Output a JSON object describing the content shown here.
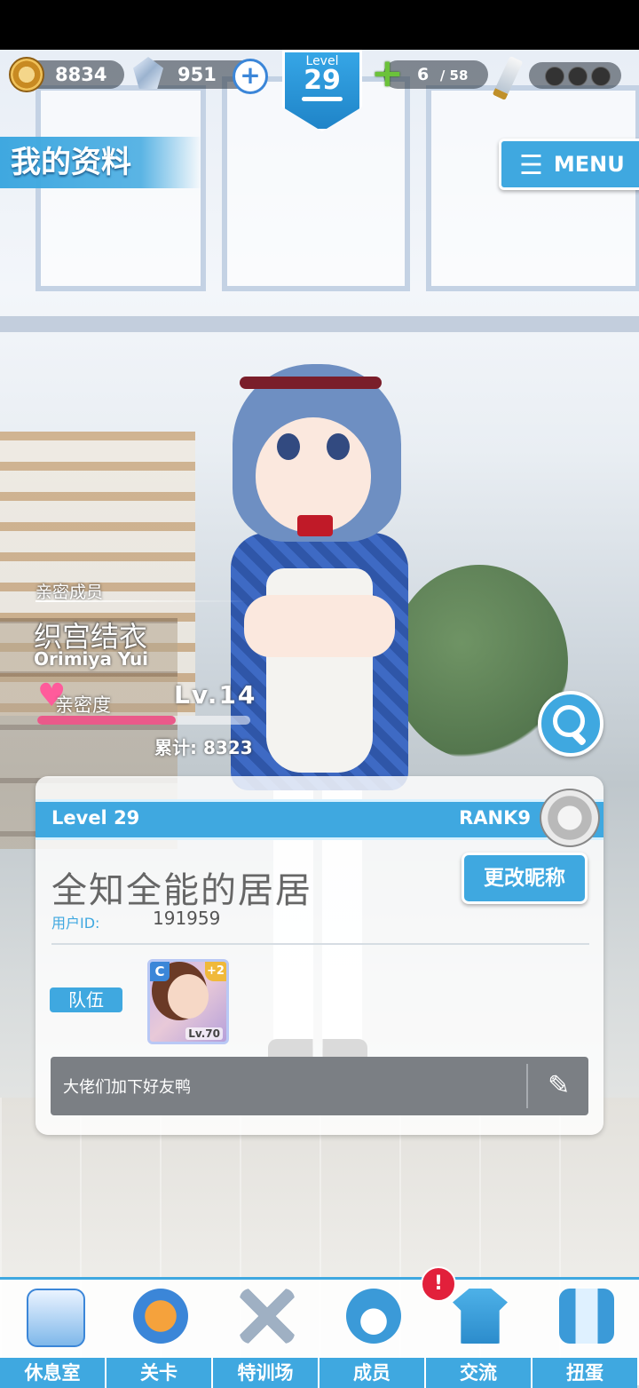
{
  "status": {
    "coins": "8834",
    "gems": "951",
    "level_label": "Level",
    "level": "29",
    "stamina_current": "6",
    "stamina_max": "/ 58",
    "stamina_fraction": 0.103
  },
  "header": {
    "title": "我的资料",
    "menu_label": "MENU"
  },
  "character": {
    "tag": "亲密成员",
    "name_cn": "织宫结衣",
    "name_en": "Orimiya Yui",
    "affection_label": "亲密度",
    "affection_level": "Lv.14",
    "affection_progress": 0.65,
    "total": "累计: 8323"
  },
  "profile": {
    "level": "Level 29",
    "rank": "RANK9",
    "nickname": "全知全能的居居",
    "rename_label": "更改昵称",
    "uid_label": "用户ID:",
    "uid": "191959",
    "team_label": "队伍",
    "team_card": {
      "rarity": "C",
      "plus": "+2",
      "level": "Lv.70"
    },
    "message": "大佬们加下好友鸭"
  },
  "nav": {
    "items": [
      {
        "label": "休息室",
        "icon": "lounge-building-icon"
      },
      {
        "label": "关卡",
        "icon": "stage-monster-icon"
      },
      {
        "label": "特训场",
        "icon": "crossed-swords-icon"
      },
      {
        "label": "成员",
        "icon": "member-cat-icon"
      },
      {
        "label": "交流",
        "icon": "dress-icon"
      },
      {
        "label": "扭蛋",
        "icon": "curtain-icon"
      }
    ],
    "alert": "!"
  },
  "colors": {
    "accent": "#3fa8e0",
    "affection": "#ea5a8a",
    "alert": "#e2203b"
  }
}
